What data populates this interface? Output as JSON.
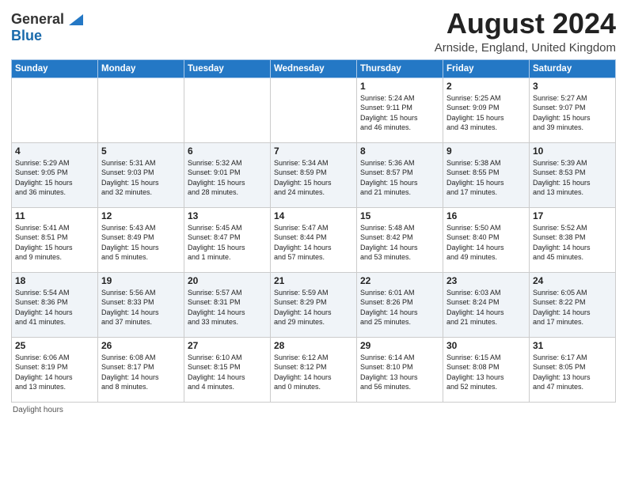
{
  "header": {
    "logo_line1": "General",
    "logo_line2": "Blue",
    "month_year": "August 2024",
    "location": "Arnside, England, United Kingdom"
  },
  "days_of_week": [
    "Sunday",
    "Monday",
    "Tuesday",
    "Wednesday",
    "Thursday",
    "Friday",
    "Saturday"
  ],
  "weeks": [
    [
      {
        "day": "",
        "info": ""
      },
      {
        "day": "",
        "info": ""
      },
      {
        "day": "",
        "info": ""
      },
      {
        "day": "",
        "info": ""
      },
      {
        "day": "1",
        "info": "Sunrise: 5:24 AM\nSunset: 9:11 PM\nDaylight: 15 hours\nand 46 minutes."
      },
      {
        "day": "2",
        "info": "Sunrise: 5:25 AM\nSunset: 9:09 PM\nDaylight: 15 hours\nand 43 minutes."
      },
      {
        "day": "3",
        "info": "Sunrise: 5:27 AM\nSunset: 9:07 PM\nDaylight: 15 hours\nand 39 minutes."
      }
    ],
    [
      {
        "day": "4",
        "info": "Sunrise: 5:29 AM\nSunset: 9:05 PM\nDaylight: 15 hours\nand 36 minutes."
      },
      {
        "day": "5",
        "info": "Sunrise: 5:31 AM\nSunset: 9:03 PM\nDaylight: 15 hours\nand 32 minutes."
      },
      {
        "day": "6",
        "info": "Sunrise: 5:32 AM\nSunset: 9:01 PM\nDaylight: 15 hours\nand 28 minutes."
      },
      {
        "day": "7",
        "info": "Sunrise: 5:34 AM\nSunset: 8:59 PM\nDaylight: 15 hours\nand 24 minutes."
      },
      {
        "day": "8",
        "info": "Sunrise: 5:36 AM\nSunset: 8:57 PM\nDaylight: 15 hours\nand 21 minutes."
      },
      {
        "day": "9",
        "info": "Sunrise: 5:38 AM\nSunset: 8:55 PM\nDaylight: 15 hours\nand 17 minutes."
      },
      {
        "day": "10",
        "info": "Sunrise: 5:39 AM\nSunset: 8:53 PM\nDaylight: 15 hours\nand 13 minutes."
      }
    ],
    [
      {
        "day": "11",
        "info": "Sunrise: 5:41 AM\nSunset: 8:51 PM\nDaylight: 15 hours\nand 9 minutes."
      },
      {
        "day": "12",
        "info": "Sunrise: 5:43 AM\nSunset: 8:49 PM\nDaylight: 15 hours\nand 5 minutes."
      },
      {
        "day": "13",
        "info": "Sunrise: 5:45 AM\nSunset: 8:47 PM\nDaylight: 15 hours\nand 1 minute."
      },
      {
        "day": "14",
        "info": "Sunrise: 5:47 AM\nSunset: 8:44 PM\nDaylight: 14 hours\nand 57 minutes."
      },
      {
        "day": "15",
        "info": "Sunrise: 5:48 AM\nSunset: 8:42 PM\nDaylight: 14 hours\nand 53 minutes."
      },
      {
        "day": "16",
        "info": "Sunrise: 5:50 AM\nSunset: 8:40 PM\nDaylight: 14 hours\nand 49 minutes."
      },
      {
        "day": "17",
        "info": "Sunrise: 5:52 AM\nSunset: 8:38 PM\nDaylight: 14 hours\nand 45 minutes."
      }
    ],
    [
      {
        "day": "18",
        "info": "Sunrise: 5:54 AM\nSunset: 8:36 PM\nDaylight: 14 hours\nand 41 minutes."
      },
      {
        "day": "19",
        "info": "Sunrise: 5:56 AM\nSunset: 8:33 PM\nDaylight: 14 hours\nand 37 minutes."
      },
      {
        "day": "20",
        "info": "Sunrise: 5:57 AM\nSunset: 8:31 PM\nDaylight: 14 hours\nand 33 minutes."
      },
      {
        "day": "21",
        "info": "Sunrise: 5:59 AM\nSunset: 8:29 PM\nDaylight: 14 hours\nand 29 minutes."
      },
      {
        "day": "22",
        "info": "Sunrise: 6:01 AM\nSunset: 8:26 PM\nDaylight: 14 hours\nand 25 minutes."
      },
      {
        "day": "23",
        "info": "Sunrise: 6:03 AM\nSunset: 8:24 PM\nDaylight: 14 hours\nand 21 minutes."
      },
      {
        "day": "24",
        "info": "Sunrise: 6:05 AM\nSunset: 8:22 PM\nDaylight: 14 hours\nand 17 minutes."
      }
    ],
    [
      {
        "day": "25",
        "info": "Sunrise: 6:06 AM\nSunset: 8:19 PM\nDaylight: 14 hours\nand 13 minutes."
      },
      {
        "day": "26",
        "info": "Sunrise: 6:08 AM\nSunset: 8:17 PM\nDaylight: 14 hours\nand 8 minutes."
      },
      {
        "day": "27",
        "info": "Sunrise: 6:10 AM\nSunset: 8:15 PM\nDaylight: 14 hours\nand 4 minutes."
      },
      {
        "day": "28",
        "info": "Sunrise: 6:12 AM\nSunset: 8:12 PM\nDaylight: 14 hours\nand 0 minutes."
      },
      {
        "day": "29",
        "info": "Sunrise: 6:14 AM\nSunset: 8:10 PM\nDaylight: 13 hours\nand 56 minutes."
      },
      {
        "day": "30",
        "info": "Sunrise: 6:15 AM\nSunset: 8:08 PM\nDaylight: 13 hours\nand 52 minutes."
      },
      {
        "day": "31",
        "info": "Sunrise: 6:17 AM\nSunset: 8:05 PM\nDaylight: 13 hours\nand 47 minutes."
      }
    ]
  ],
  "footer": {
    "note": "Daylight hours"
  }
}
